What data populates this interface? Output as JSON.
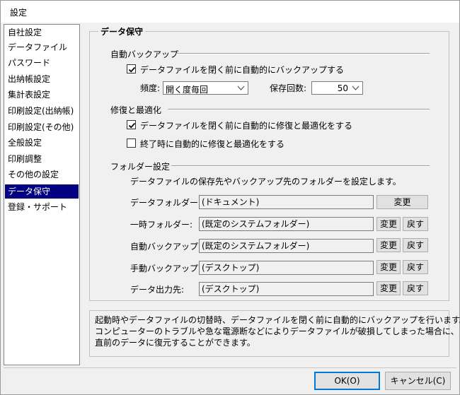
{
  "window": {
    "title": "設定"
  },
  "sidebar": {
    "items": [
      {
        "label": "自社設定",
        "selected": false
      },
      {
        "label": "データファイル",
        "selected": false
      },
      {
        "label": "パスワード",
        "selected": false
      },
      {
        "label": "出納帳設定",
        "selected": false
      },
      {
        "label": "集計表設定",
        "selected": false
      },
      {
        "label": "印刷設定(出納帳)",
        "selected": false
      },
      {
        "label": "印刷設定(その他)",
        "selected": false
      },
      {
        "label": "全般設定",
        "selected": false
      },
      {
        "label": "印刷調整",
        "selected": false
      },
      {
        "label": "その他の設定",
        "selected": false
      },
      {
        "label": "データ保守",
        "selected": true
      },
      {
        "label": "登録・サポート",
        "selected": false
      }
    ]
  },
  "panel": {
    "title": "データ保守",
    "auto_backup": {
      "heading": "自動バックアップ",
      "check_label": "データファイルを閉く前に自動的にバックアップする",
      "checked": true,
      "frequency_label": "頻度:",
      "frequency_value": "開く度毎回",
      "count_label": "保存回数:",
      "count_value": "50"
    },
    "repair": {
      "heading": "修復と最適化",
      "check1_label": "データファイルを閉く前に自動的に修復と最適化をする",
      "check1_checked": true,
      "check2_label": "終了時に自動的に修復と最適化をする",
      "check2_checked": false
    },
    "folders": {
      "heading": "フォルダー設定",
      "description": "データファイルの保存先やバックアップ先のフォルダーを設定します。",
      "change_label": "変更",
      "reset_label": "戻す",
      "rows": [
        {
          "label": "データフォルダー:",
          "value": "(ドキュメント)"
        },
        {
          "label": "一時フォルダー:",
          "value": "(既定のシステムフォルダー)"
        },
        {
          "label": "自動バックアップ:",
          "value": "(既定のシステムフォルダー)"
        },
        {
          "label": "手動バックアップ:",
          "value": "(デスクトップ)"
        },
        {
          "label": "データ出力先:",
          "value": "(デスクトップ)"
        }
      ]
    }
  },
  "help_text": {
    "line1": "起動時やデータファイルの切替時、データファイルを閉く前に自動的にバックアップを行います。",
    "line2": "コンピューターのトラブルや急な電源断などによりデータファイルが破損してしまった場合に、",
    "line3": "直前のデータに復元することができます。"
  },
  "buttons": {
    "ok": "OK(O)",
    "cancel": "キャンセル(C)"
  }
}
